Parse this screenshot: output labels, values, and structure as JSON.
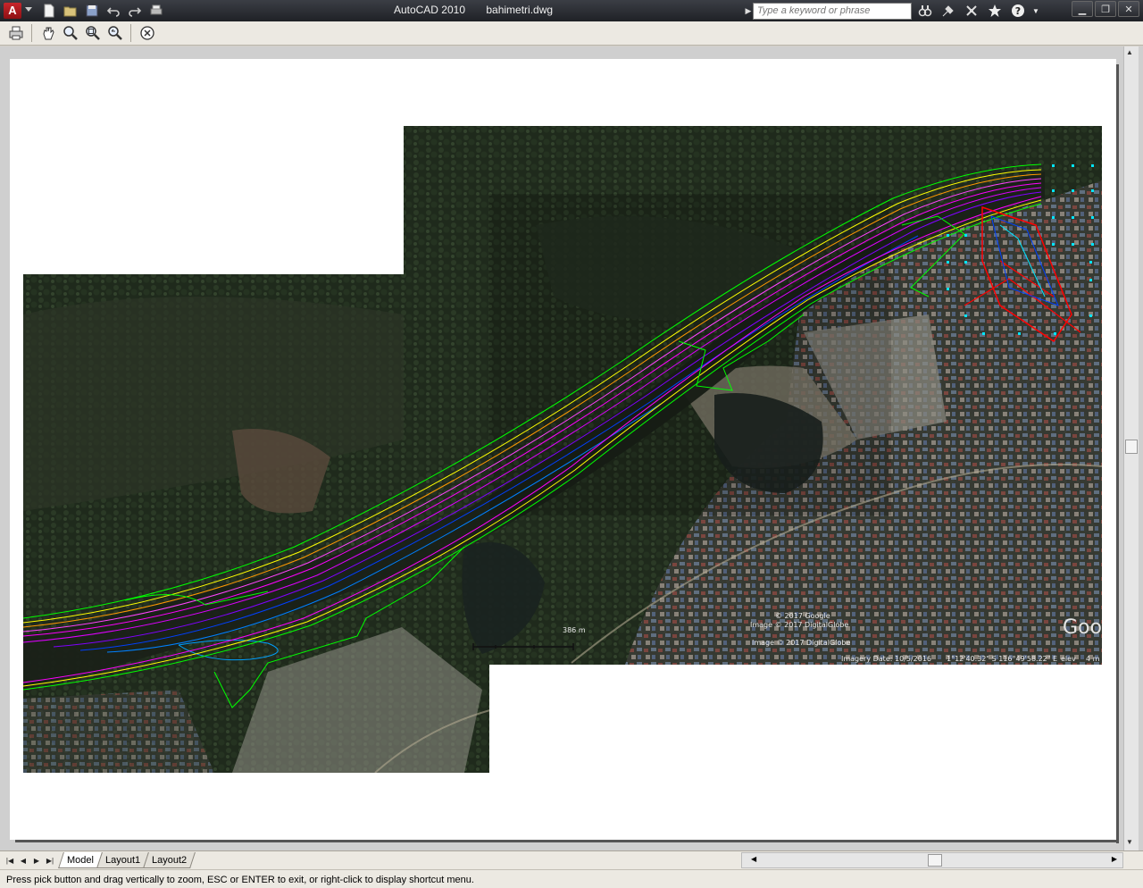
{
  "title": {
    "app_name": "AutoCAD 2010",
    "file_name": "bahimetri.dwg"
  },
  "search": {
    "placeholder": "Type a keyword or phrase"
  },
  "quick_access": [
    "new-icon",
    "open-icon",
    "save-icon",
    "undo-icon",
    "redo-icon",
    "plot-icon"
  ],
  "infocenter": [
    "binoculars-icon",
    "communication-center-icon",
    "subscription-icon",
    "favorites-icon",
    "help-icon"
  ],
  "window_controls": [
    "minimize",
    "restore",
    "close"
  ],
  "toolbar": [
    "plot-icon",
    "pan-icon",
    "zoom-icon",
    "zoom-window-icon",
    "zoom-previous-icon",
    "close-preview-icon"
  ],
  "layout_tabs": [
    {
      "label": "Model",
      "active": true
    },
    {
      "label": "Layout1",
      "active": false
    },
    {
      "label": "Layout2",
      "active": false
    }
  ],
  "map_labels": {
    "scale": "386 m",
    "copyright_1": "© 2017 Google",
    "copyright_2": "Image © 2017 DigitalGlobe",
    "copyright_3": "Image © 2017 DigitalGlobe",
    "imagery_date": "Imagery Date: 10/5/2016",
    "coords": "1°12'40.32\" S   116°49'58.22\" E",
    "elev": "elev",
    "alt": "4 m",
    "logo": "Goo"
  },
  "status": {
    "message": "Press pick button and drag vertically to zoom, ESC or ENTER to exit, or right-click to display shortcut menu."
  },
  "colors": {
    "canvas_bg": "#ffffff",
    "title_bar": "#2b2d32",
    "contour_magenta": "#ff00ff",
    "contour_yellow": "#ffff00",
    "contour_green": "#00ff00",
    "contour_blue": "#0040ff",
    "contour_orange": "#ff9900",
    "survey_red": "#ff0000",
    "grid_cyan": "#00e5ff"
  }
}
